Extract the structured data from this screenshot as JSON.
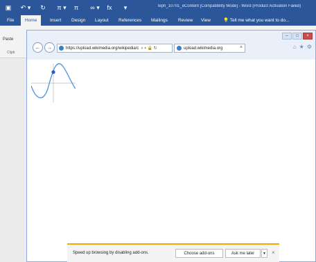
{
  "word": {
    "caption": "leph_10701_eContent [Compatibility Mode] - Word (Product Activation Failed)",
    "qat": [
      "▣",
      "↶ ▾",
      "↻",
      "π ▾",
      "π",
      "∞ ▾",
      "fx",
      "▾"
    ],
    "tabs": [
      "File",
      "Home",
      "Insert",
      "Design",
      "Layout",
      "References",
      "Mailings",
      "Review",
      "View"
    ],
    "tell_me": "Tell me what you want to do...",
    "paste": "Paste",
    "clipboard": "Clipb"
  },
  "ie": {
    "address": "https://upload.wikimedia.org/wikipedia/c",
    "address_controls": "⌕ ▾ 🔒 ↻",
    "tab_title": "upload.wikimedia.org",
    "tab_close": "×",
    "toolbar_icons": [
      "⌂",
      "★",
      "⚙"
    ],
    "window_buttons": [
      "–",
      "□",
      "×"
    ]
  },
  "notification": {
    "message": "Speed up browsing by disabling add-ons.",
    "choose": "Choose add-ons",
    "ask_later": "Ask me later",
    "close": "×"
  },
  "colors": {
    "word_blue": "#2b579a",
    "curve": "#4a90e2",
    "notify_bar": "#f2a900"
  }
}
